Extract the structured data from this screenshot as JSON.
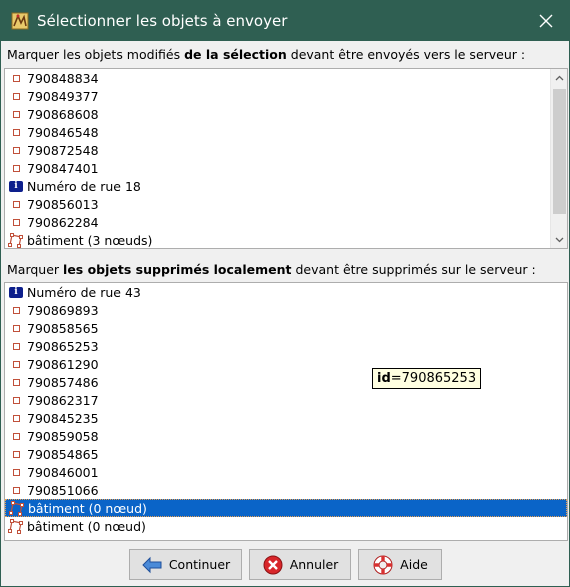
{
  "window": {
    "title": "Sélectionner les objets à envoyer"
  },
  "modified": {
    "label_pre": "Marquer les objets modifiés ",
    "label_bold": "de la sélection",
    "label_post": " devant être envoyés vers le serveur :",
    "items": [
      {
        "icon": "node-icon",
        "text": "790848834"
      },
      {
        "icon": "node-icon",
        "text": "790849377"
      },
      {
        "icon": "node-icon",
        "text": "790868608"
      },
      {
        "icon": "node-icon",
        "text": "790846548"
      },
      {
        "icon": "node-icon",
        "text": "790872548"
      },
      {
        "icon": "node-icon",
        "text": "790847401"
      },
      {
        "icon": "info-poi-icon",
        "text": "Numéro de rue 18"
      },
      {
        "icon": "node-icon",
        "text": "790856013"
      },
      {
        "icon": "node-icon",
        "text": "790862284"
      },
      {
        "icon": "way-icon",
        "text": "bâtiment (3 nœuds)"
      }
    ]
  },
  "deleted": {
    "label_pre": "Marquer ",
    "label_bold": "les objets supprimés localement",
    "label_post": " devant être supprimés sur le serveur :",
    "items": [
      {
        "icon": "info-poi-icon",
        "text": "Numéro de rue 43"
      },
      {
        "icon": "node-icon",
        "text": "790869893"
      },
      {
        "icon": "node-icon",
        "text": "790858565"
      },
      {
        "icon": "node-icon",
        "text": "790865253"
      },
      {
        "icon": "node-icon",
        "text": "790861290"
      },
      {
        "icon": "node-icon",
        "text": "790857486"
      },
      {
        "icon": "node-icon",
        "text": "790862317"
      },
      {
        "icon": "node-icon",
        "text": "790845235"
      },
      {
        "icon": "node-icon",
        "text": "790859058"
      },
      {
        "icon": "node-icon",
        "text": "790854865"
      },
      {
        "icon": "node-icon",
        "text": "790846001"
      },
      {
        "icon": "node-icon",
        "text": "790851066"
      },
      {
        "icon": "way-icon",
        "text": "bâtiment (0 nœud)",
        "selected": true
      },
      {
        "icon": "way-icon",
        "text": "bâtiment (0 nœud)"
      }
    ]
  },
  "tooltip": {
    "key": "id",
    "value": "=790865253"
  },
  "buttons": {
    "continue": "Continuer",
    "cancel": "Annuler",
    "help": "Aide"
  },
  "colors": {
    "titlebar": "#2f5f52",
    "selection": "#0a64c8",
    "node": "#c0503a",
    "poi": "#0d1f8c"
  }
}
